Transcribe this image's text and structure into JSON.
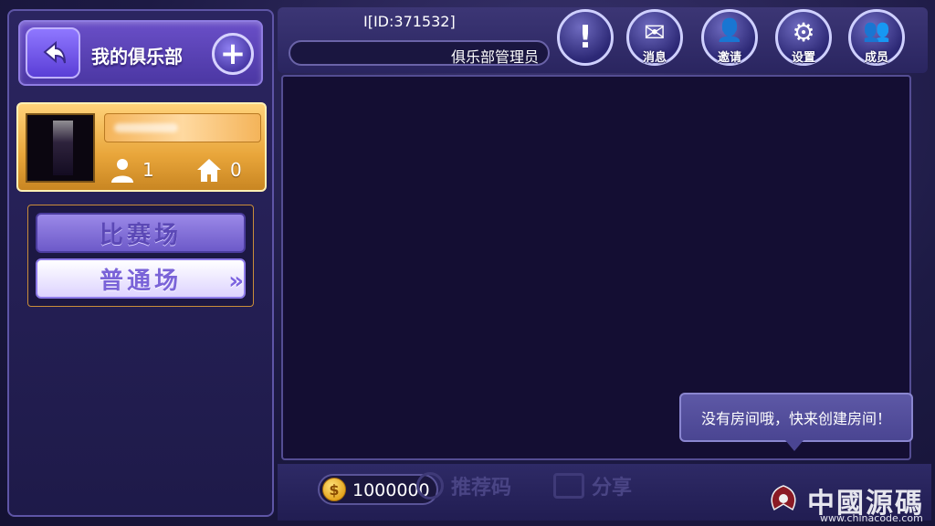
{
  "club": {
    "title": "我的俱乐部",
    "add_symbol": "+",
    "member_count": "1",
    "room_count": "0"
  },
  "modes": {
    "match": "比赛场",
    "normal": "普通场"
  },
  "header": {
    "user_id": "I[ID:371532]",
    "role": "俱乐部管理员",
    "buttons": [
      {
        "label": "",
        "icon": "exclamation-icon",
        "glyph": "!"
      },
      {
        "label": "消息",
        "icon": "envelope-icon",
        "glyph": "✉"
      },
      {
        "label": "邀请",
        "icon": "invite-user-icon",
        "glyph": "👤"
      },
      {
        "label": "设置",
        "icon": "gear-icon",
        "glyph": "⚙"
      },
      {
        "label": "成员",
        "icon": "members-icon",
        "glyph": "👥"
      }
    ]
  },
  "main": {
    "empty_hint": "没有房间哦，快来创建房间！"
  },
  "footer": {
    "coins": "1000000",
    "coin_symbol": "$",
    "recommend_code": "推荐码",
    "share": "分享"
  },
  "watermark": {
    "name": "中國源碼",
    "site": "www.chinacode.com"
  },
  "colors": {
    "accent": "#6a4fc8",
    "gold": "#e8a53a",
    "panel": "#140e33"
  }
}
